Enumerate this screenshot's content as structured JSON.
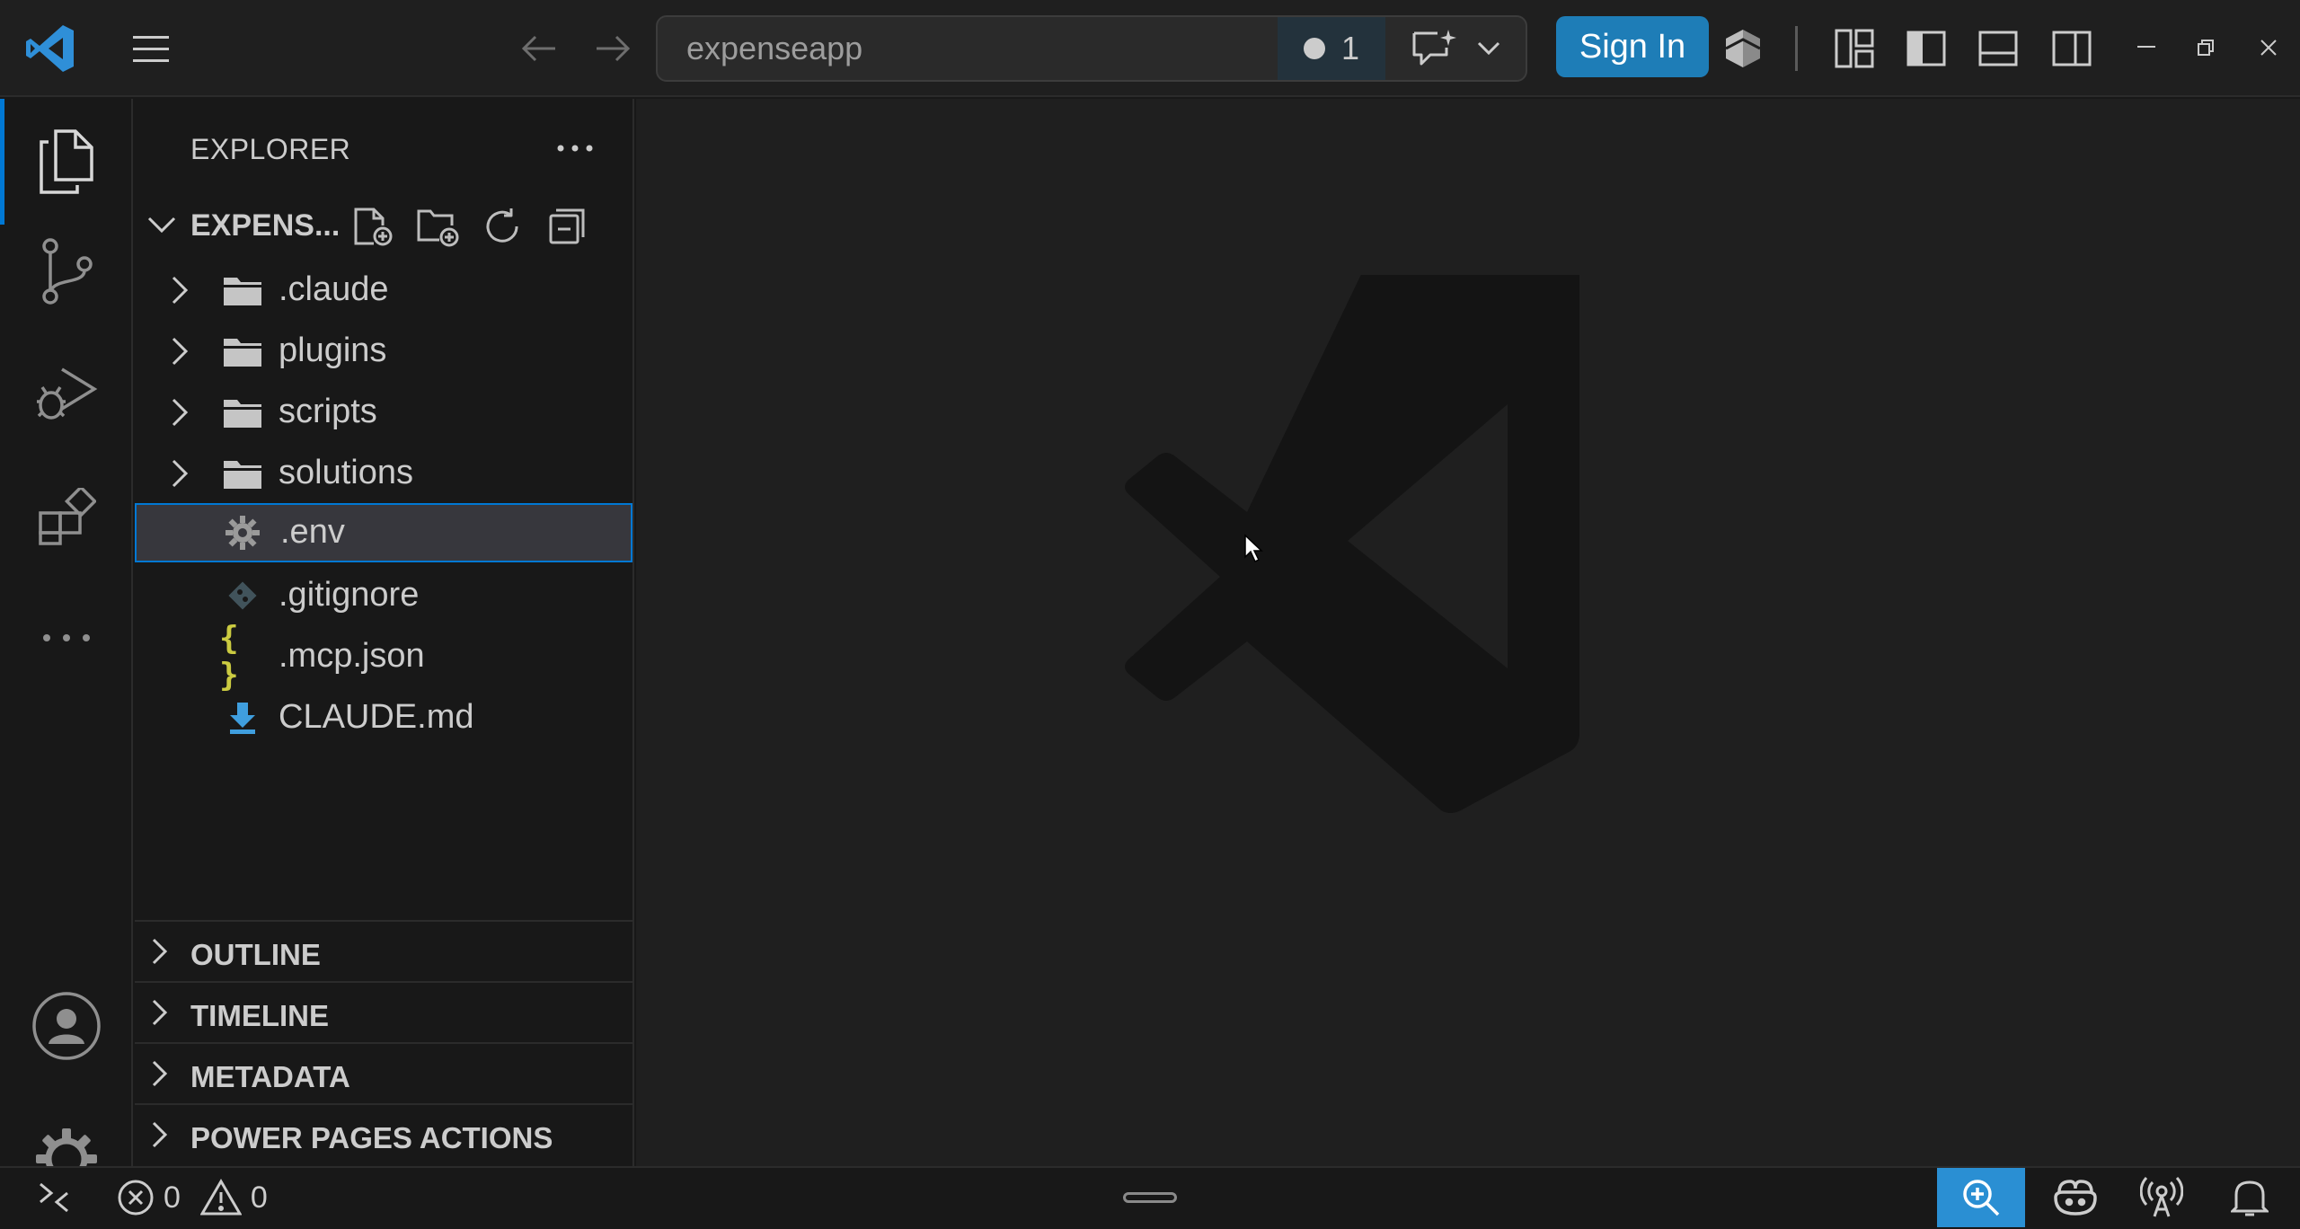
{
  "titlebar": {
    "search_text": "expenseapp",
    "badge_count": "1",
    "signin_label": "Sign In"
  },
  "explorer": {
    "title": "EXPLORER",
    "folder_name": "EXPENS...",
    "items": [
      {
        "label": ".claude",
        "type": "folder"
      },
      {
        "label": "plugins",
        "type": "folder"
      },
      {
        "label": "scripts",
        "type": "folder"
      },
      {
        "label": "solutions",
        "type": "folder"
      },
      {
        "label": ".env",
        "type": "file",
        "icon": "gear-icon",
        "selected": true
      },
      {
        "label": ".gitignore",
        "type": "file",
        "icon": "git-icon"
      },
      {
        "label": ".mcp.json",
        "type": "file",
        "icon": "braces-icon"
      },
      {
        "label": "CLAUDE.md",
        "type": "file",
        "icon": "markdown-download-icon"
      }
    ],
    "sections": [
      "OUTLINE",
      "TIMELINE",
      "METADATA",
      "POWER PAGES ACTIONS"
    ]
  },
  "statusbar": {
    "errors": "0",
    "warnings": "0"
  },
  "colors": {
    "accent": "#0078d4",
    "signin_bg": "#1e7db7",
    "zoom_bg": "#2a8fd3",
    "vscode_logo": "#2f8fd8",
    "json_icon": "#cbcb41",
    "md_icon": "#3f9ede"
  }
}
